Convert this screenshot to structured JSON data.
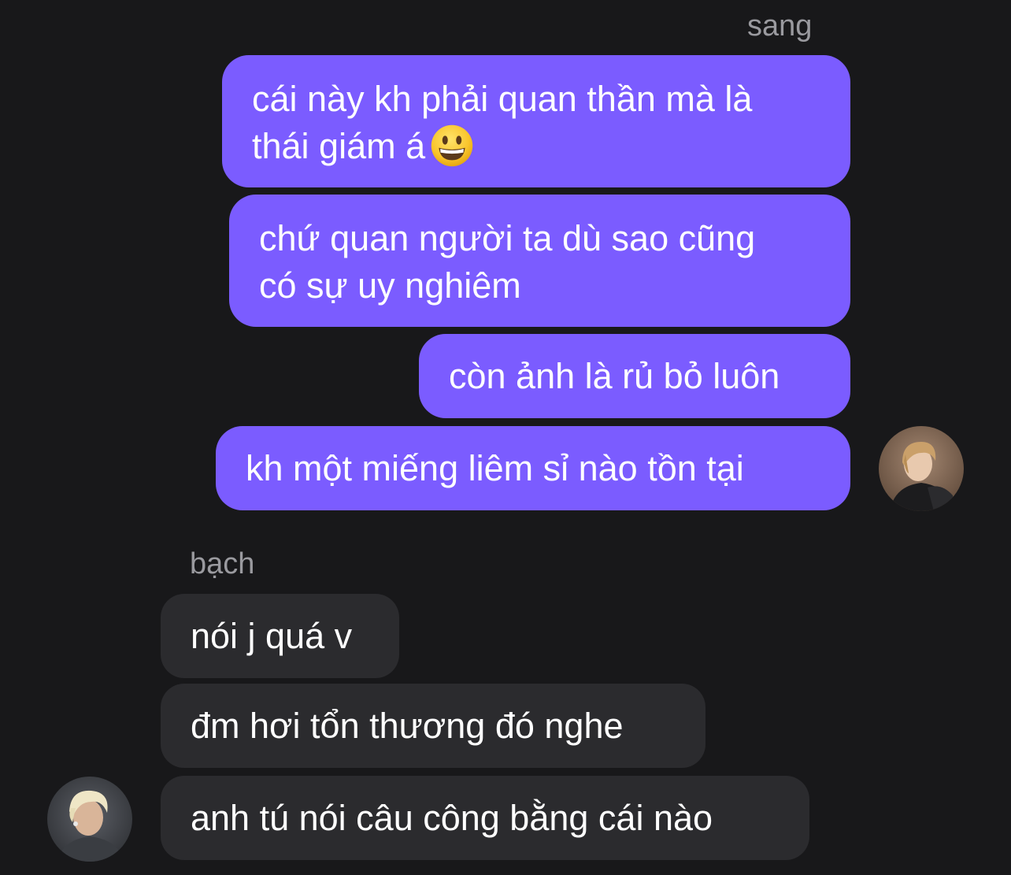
{
  "outgoing": {
    "sender": "sang",
    "messages": [
      {
        "lines": [
          "cái này kh phải quan thần mà là",
          "thái giám á"
        ],
        "emoji": "grinning-face-emoji"
      },
      {
        "lines": [
          "chứ quan người ta dù sao cũng",
          "có sự uy nghiêm"
        ]
      },
      {
        "lines": [
          "còn ảnh là rủ bỏ luôn"
        ]
      },
      {
        "lines": [
          "kh một miếng liêm sỉ nào tồn tại"
        ]
      }
    ],
    "avatar": "avatar-sang"
  },
  "incoming": {
    "sender": "bạch",
    "messages": [
      {
        "lines": [
          "nói j quá v"
        ]
      },
      {
        "lines": [
          "đm hơi tổn thương đó nghe"
        ]
      },
      {
        "lines": [
          "anh tú nói câu công bằng cái nào"
        ]
      }
    ],
    "avatar": "avatar-bach"
  },
  "colors": {
    "background": "#18181a",
    "outgoing_bubble": "#7b5cff",
    "incoming_bubble": "#2b2b2e",
    "sender_name": "#9a9a9f"
  }
}
